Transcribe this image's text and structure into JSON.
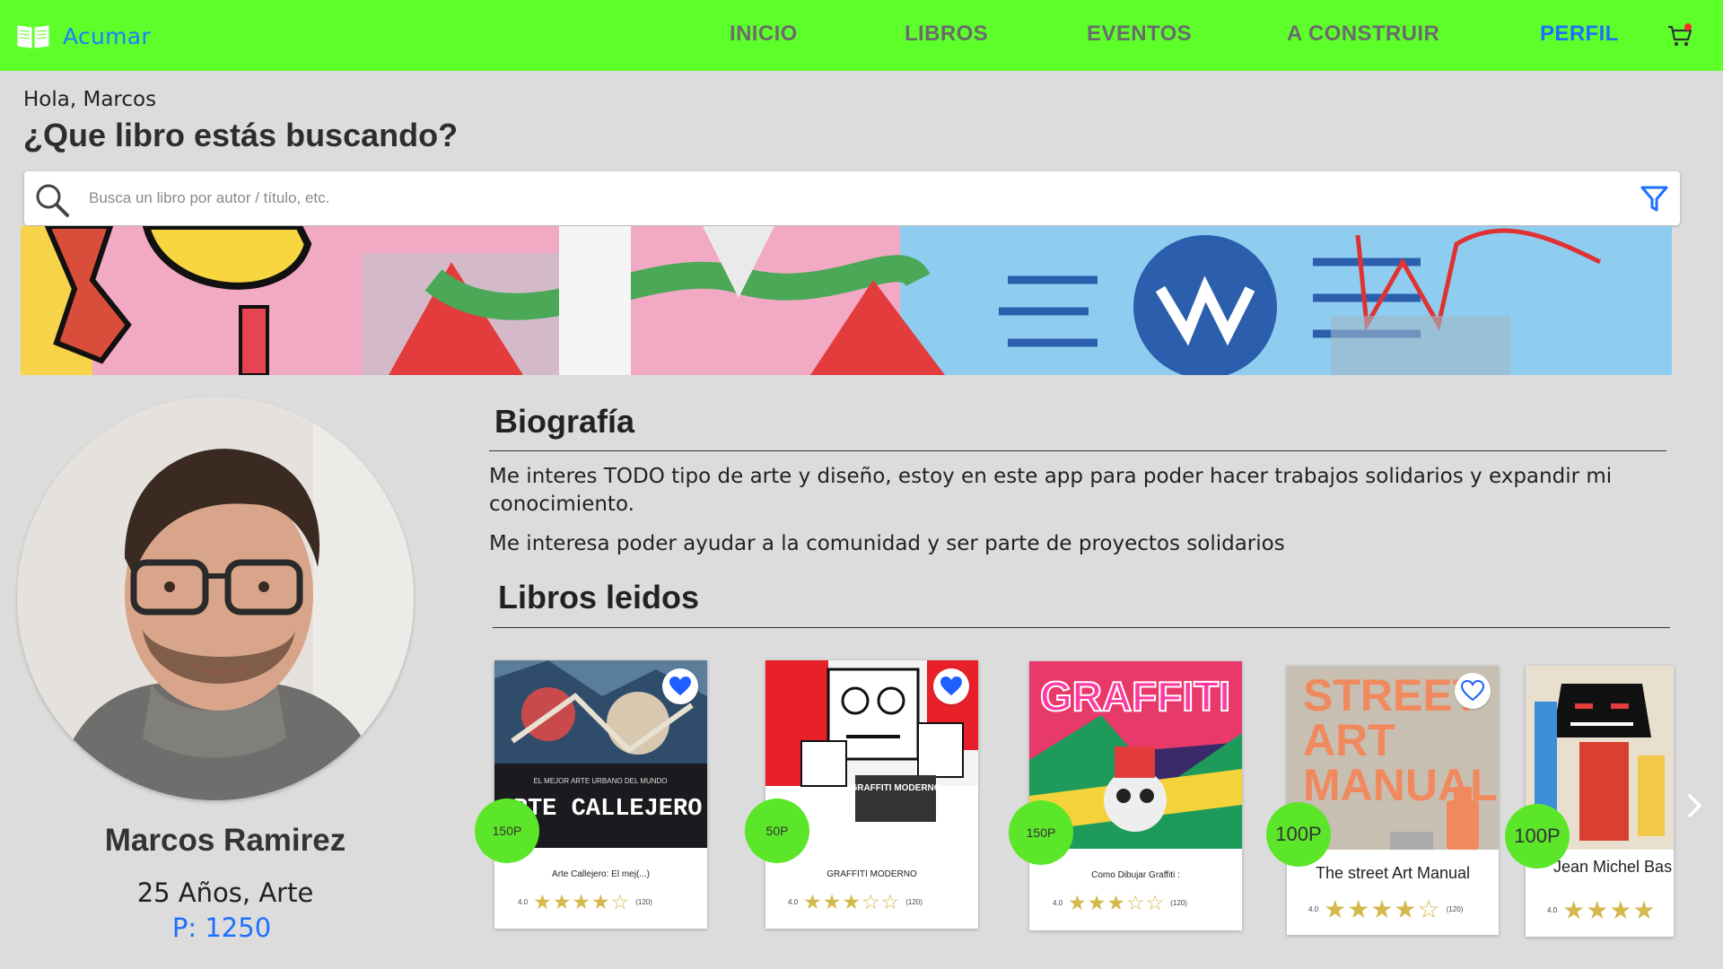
{
  "brand": {
    "name": "Acumar"
  },
  "nav": {
    "items": [
      {
        "label": "INICIO",
        "active": false
      },
      {
        "label": "LIBROS",
        "active": false
      },
      {
        "label": "EVENTOS",
        "active": false
      },
      {
        "label": "A CONSTRUIR",
        "active": false
      },
      {
        "label": "PERFIL",
        "active": true
      }
    ],
    "cart_icon": "cart-icon"
  },
  "greeting": "Hola, Marcos",
  "question": "¿Que libro estás buscando?",
  "search": {
    "placeholder": "Busca un libro por autor / título, etc.",
    "value": ""
  },
  "profile": {
    "name": "Marcos Ramirez",
    "info": "25 Años, Arte",
    "points": "P: 1250"
  },
  "biography": {
    "title": "Biografía",
    "paragraphs": [
      "Me interes TODO tipo de arte y diseño, estoy en este app para poder hacer trabajos solidarios y expandir mi conocimiento.",
      "Me interesa poder ayudar a la comunidad y ser parte de proyectos solidarios"
    ]
  },
  "books": {
    "title": "Libros leidos",
    "items": [
      {
        "title": "Arte Callejero: El mej(...)",
        "rating": "4.0",
        "stars": "★★★★☆",
        "reviews": "(120)",
        "price": "150P",
        "favorite": true,
        "cover_text": "ARTE CALLEJERO",
        "cover_sub": "EL MEJOR ARTE URBANO DEL MUNDO"
      },
      {
        "title": "GRAFFITI MODERNO",
        "rating": "4.0",
        "stars": "★★★☆☆",
        "reviews": "(120)",
        "price": "50P",
        "favorite": true,
        "cover_text": "GRAFFITI MODERNO"
      },
      {
        "title": "Como Dibujar Graffiti :",
        "rating": "4.0",
        "stars": "★★★☆☆",
        "reviews": "(120)",
        "price": "150P",
        "favorite": false,
        "cover_text": "GRAFFITI"
      },
      {
        "title": "The street Art Manual",
        "rating": "4.0",
        "stars": "★★★★☆",
        "reviews": "(120)",
        "price": "100P",
        "favorite": false,
        "cover_text": "STREET ART MANUAL"
      },
      {
        "title": "Jean Michel Bas",
        "rating": "4.0",
        "stars": "★★★★",
        "reviews": "",
        "price": "100P",
        "favorite": false
      }
    ]
  },
  "colors": {
    "nav_bg": "#5dff2b",
    "accent_blue": "#1f6fff",
    "price_green": "#5ce62a",
    "star_gold": "#d4b94c",
    "page_bg": "#dcdcdc"
  }
}
